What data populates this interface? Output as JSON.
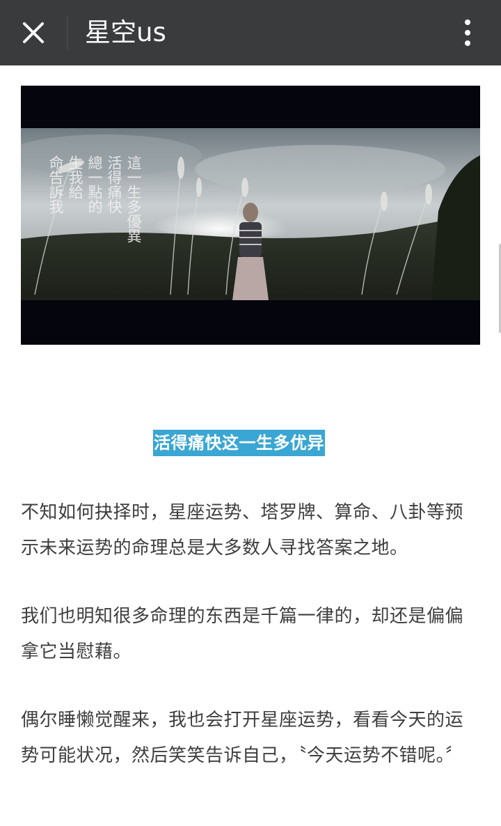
{
  "header": {
    "title": "星空us",
    "close_icon": "close-icon",
    "more_icon": "more-vertical-icon"
  },
  "video": {
    "lyric_columns": [
      "這一生多優異",
      "活得痛快",
      "總一點的",
      "生我給",
      "命告訴我"
    ]
  },
  "article": {
    "heading": "活得痛快这一生多优异",
    "heading_bg": "#3aa6d3",
    "paragraphs": [
      "不知如何抉择时，星座运势、塔罗牌、算命、八卦等预示未来运势的命理总是大多数人寻找答案之地。",
      "我们也明知很多命理的东西是千篇一律的，却还是偏偏拿它当慰藉。",
      "偶尔睡懒觉醒来，我也会打开星座运势，看看今天的运势可能状况，然后笑笑告诉自己，〝今天运势不错呢。〞"
    ]
  }
}
